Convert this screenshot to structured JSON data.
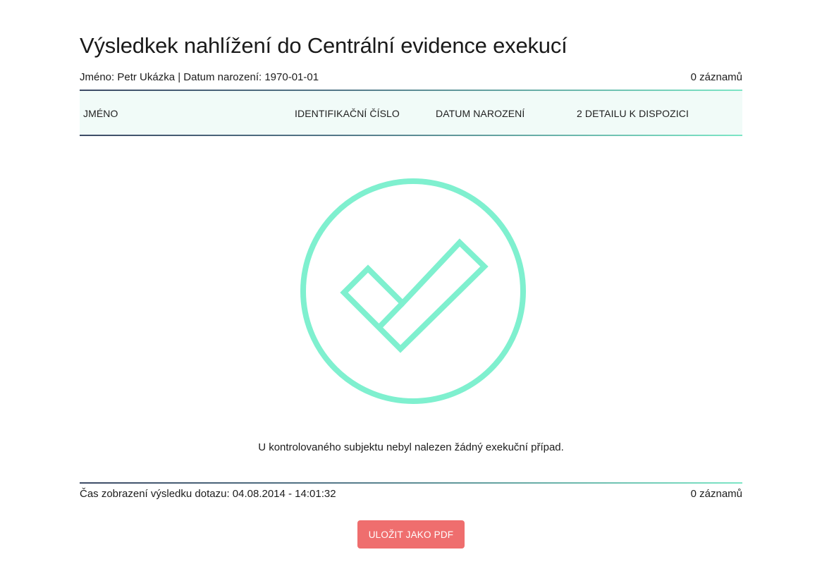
{
  "page": {
    "title": "Výsledkek nahlížení do Centrální evidence exekucí"
  },
  "subject": {
    "info": "Jméno: Petr Ukázka | Datum narození: 1970-01-01",
    "record_count": "0 záznamů"
  },
  "table": {
    "columns": [
      "JMÉNO",
      "IDENTIFIKAČNÍ ČÍSLO",
      "DATUM NAROZENÍ",
      "2 DETAILU K DISPOZICI"
    ]
  },
  "result": {
    "icon": "check-circle-icon",
    "message": "U kontrolovaného subjektu nebyl nalezen žádný exekuční případ.",
    "accent_color": "#7ff0cf"
  },
  "footer": {
    "query_time": "Čas zobrazení výsledku dotazu: 04.08.2014 - 14:01:32",
    "record_count": "0 záznamů"
  },
  "actions": {
    "save_pdf_label": "ULOŽIT JAKO PDF",
    "button_color": "#ef6e6e"
  }
}
